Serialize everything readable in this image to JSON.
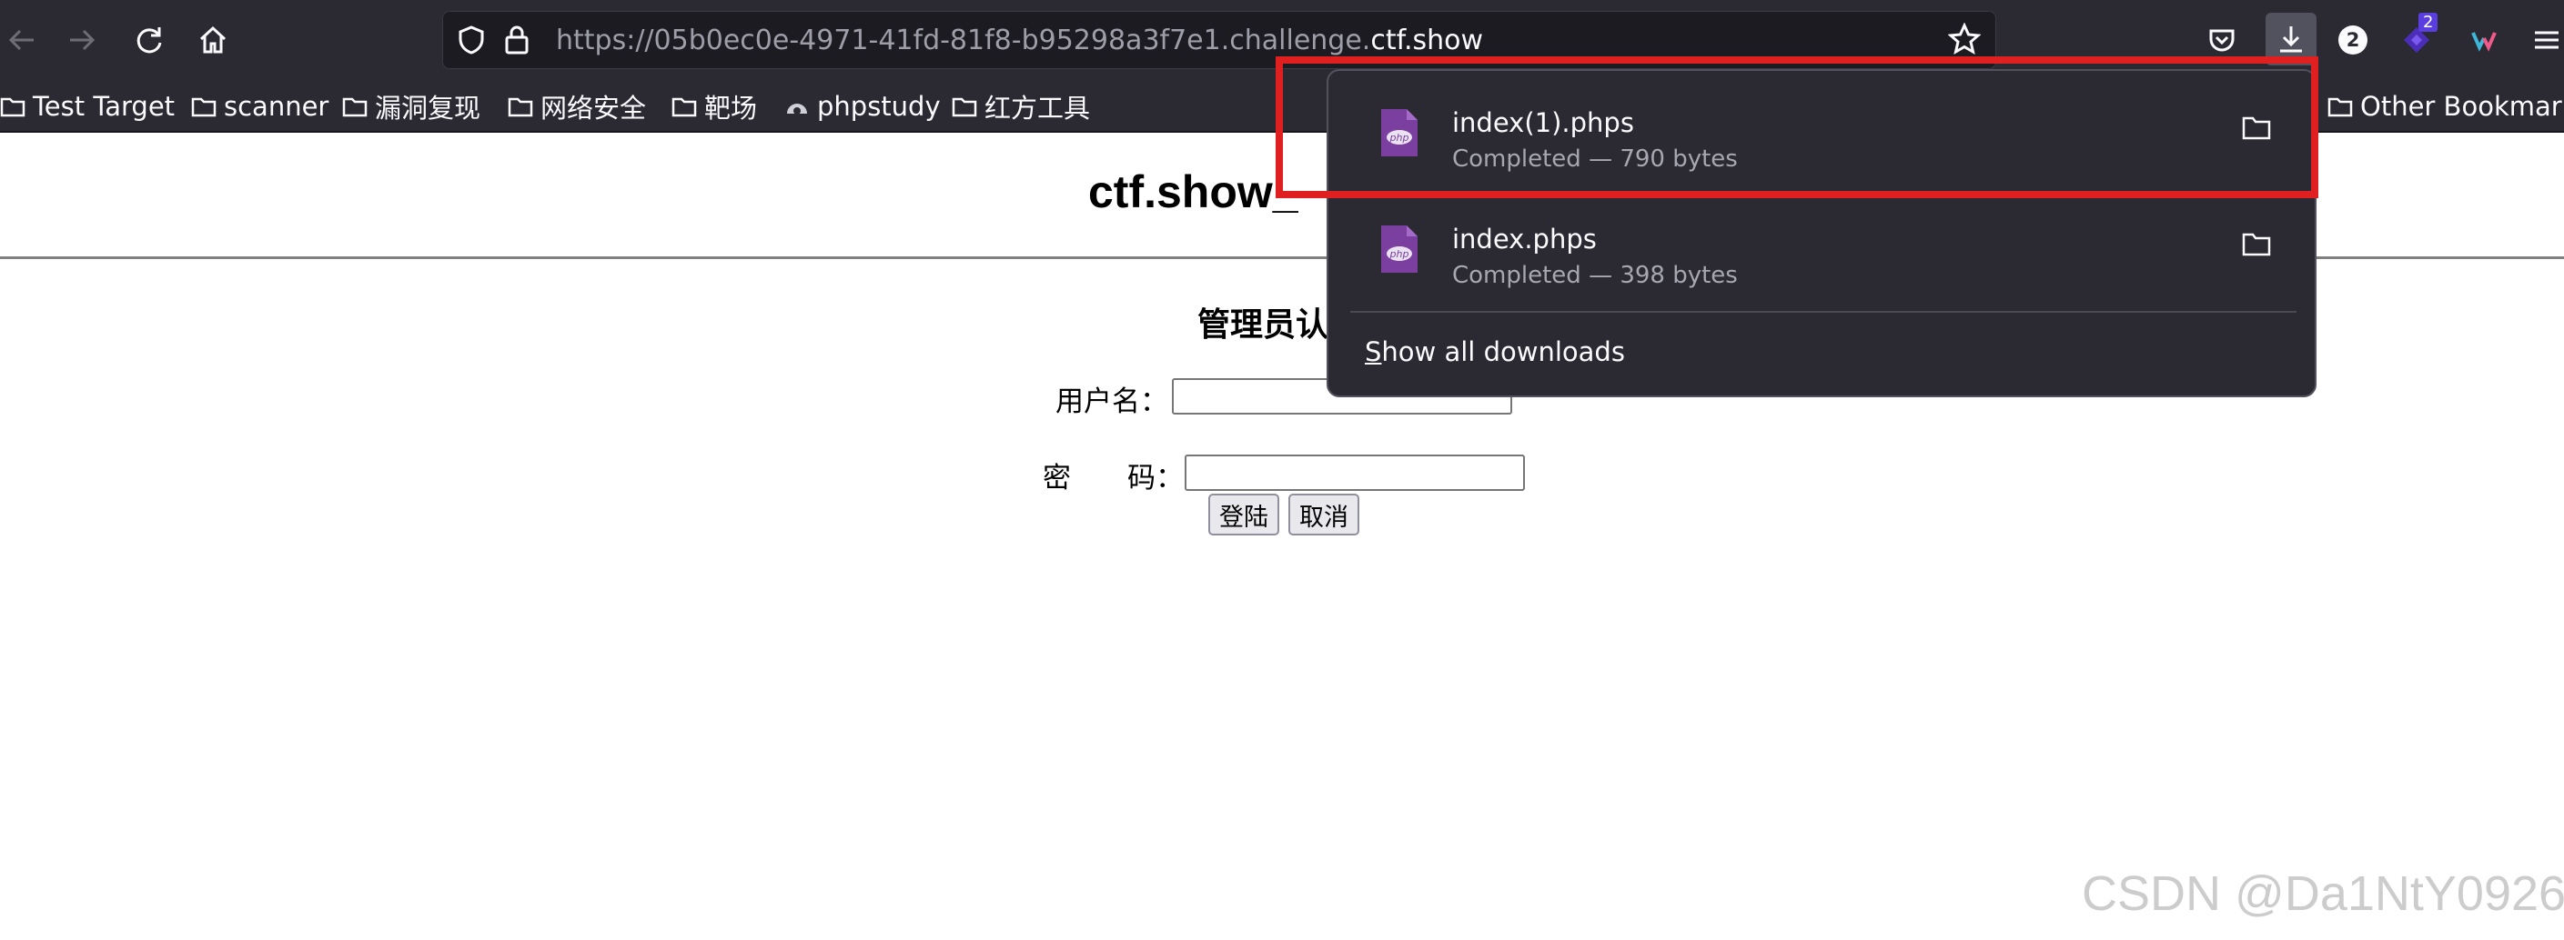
{
  "browser": {
    "url_prefix": "https://05b0ec0e-4971-41fd-81f8-b95298a3f7e1.challenge.",
    "url_host": "ctf.show",
    "notification_badge": "2",
    "extension_badge": "2"
  },
  "bookmarks": {
    "items": [
      {
        "label": "Test Target",
        "icon": "folder-icon"
      },
      {
        "label": "scanner",
        "icon": "folder-icon"
      },
      {
        "label": "漏洞复现",
        "icon": "folder-icon"
      },
      {
        "label": "网络安全",
        "icon": "folder-icon"
      },
      {
        "label": "靶场",
        "icon": "folder-icon"
      },
      {
        "label": "phpstudy",
        "icon": "phpstudy-icon"
      },
      {
        "label": "红方工具",
        "icon": "folder-icon"
      }
    ],
    "other": "Other Bookmarks"
  },
  "page": {
    "title": "ctf.show_",
    "form_heading": "管理员认",
    "username_label": "用户名：",
    "password_label": "密　　码：",
    "login_button": "登陆",
    "cancel_button": "取消"
  },
  "downloads": {
    "items": [
      {
        "name": "index(1).phps",
        "status": "Completed — 790 bytes",
        "icon": "php-file-icon"
      },
      {
        "name": "index.phps",
        "status": "Completed — 398 bytes",
        "icon": "php-file-icon"
      }
    ],
    "show_all_key": "S",
    "show_all_rest": "how all downloads"
  },
  "colors": {
    "toolbar": "#2b2a33",
    "highlight": "#e02020",
    "php_icon": "#7b3fa0"
  },
  "watermark": "CSDN @Da1NtY0926"
}
